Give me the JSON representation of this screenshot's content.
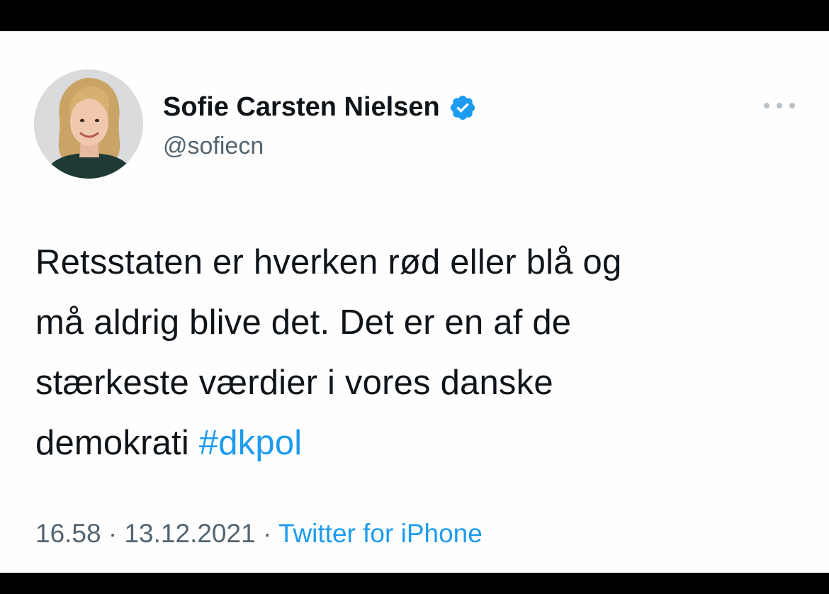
{
  "tweet": {
    "author": {
      "name": "Sofie Carsten Nielsen",
      "handle": "@sofiecn",
      "verified_icon": "verified-badge-icon"
    },
    "more_icon": "more-options-icon",
    "text_lines": [
      "Retsstaten er hverken rød eller blå og",
      "må aldrig blive det. Det er en af de",
      "stærkeste værdier i vores danske",
      "demokrati"
    ],
    "hashtag": "#dkpol",
    "time": "16.58",
    "separator": "·",
    "date": "13.12.2021",
    "source": "Twitter for iPhone"
  },
  "colors": {
    "text": "#0f1419",
    "muted": "#536471",
    "accent": "#1d9bf0",
    "background": "#fefefe",
    "frame": "#000000"
  }
}
